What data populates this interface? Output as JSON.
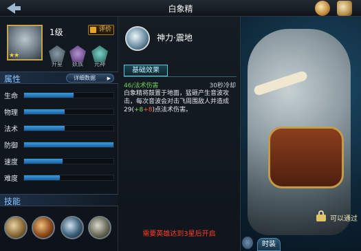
{
  "header": {
    "title": "白象精",
    "icons": [
      "back-arrow-icon",
      "gift-icon",
      "scroll-icon"
    ]
  },
  "hero": {
    "level": "1级",
    "stars": "★★",
    "review_label": "评价",
    "sub_buttons": [
      {
        "label": "升星",
        "icon": "star-upgrade-icon"
      },
      {
        "label": "妖族",
        "icon": "demon-clan-icon"
      },
      {
        "label": "元神",
        "icon": "spirit-icon"
      }
    ]
  },
  "attributes": {
    "section_title": "属性",
    "detail_button": "详细数据",
    "stats": [
      {
        "name": "生命",
        "fill": 0.55
      },
      {
        "name": "物理",
        "fill": 0.45
      },
      {
        "name": "法术",
        "fill": 0.45
      },
      {
        "name": "防御",
        "fill": 1.0
      },
      {
        "name": "速度",
        "fill": 0.43
      },
      {
        "name": "难度",
        "fill": 0.4
      }
    ]
  },
  "skills_section": {
    "section_title": "技能",
    "icons": [
      "skill-1-icon",
      "skill-2-icon",
      "skill-3-icon",
      "skill-4-icon"
    ]
  },
  "skill_detail": {
    "name": "神力·震地",
    "tab": "基础效果",
    "damage_type": "46/法术伤害",
    "cooldown": "30秒冷却",
    "description_part1": "白象精将鼓置于地面，猛砸产生音波攻击，每次音波会对击飞周围敌人并造成29(",
    "description_bonus1": "+8",
    "description_bonus2": "+8",
    "description_part2": ")点法术伤害。",
    "unlock_notice": "需要英雄达到3星后开启"
  },
  "right_panel": {
    "lock_text": "可以通过",
    "bottom_tab": "时装"
  }
}
